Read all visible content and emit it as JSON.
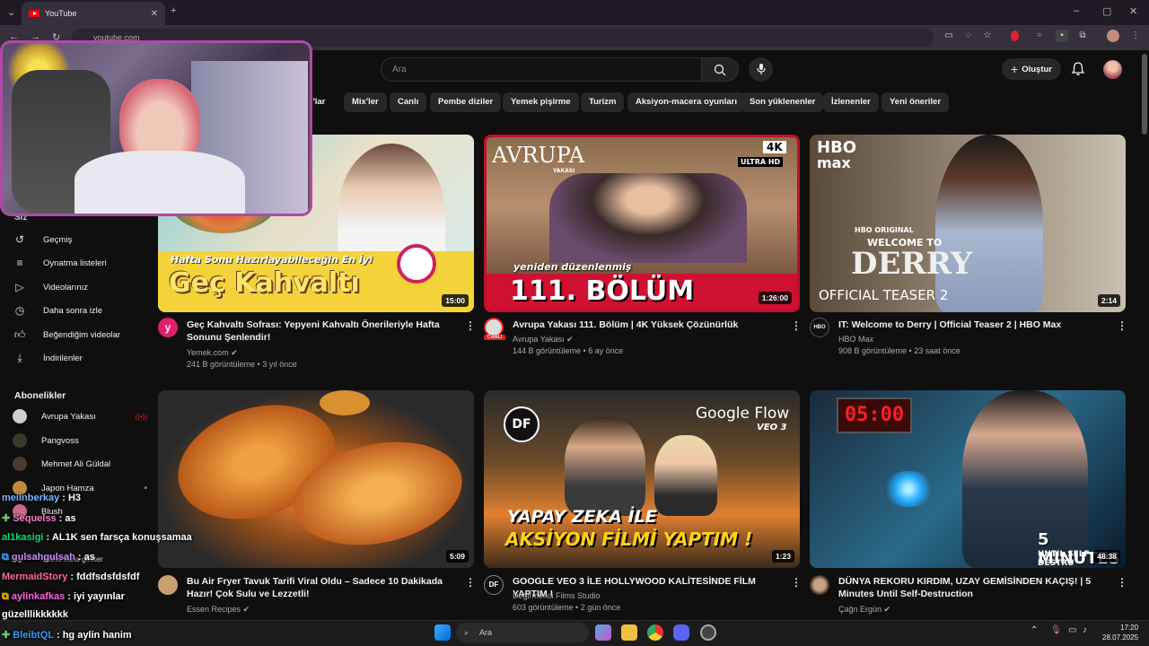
{
  "browser": {
    "tab_title": "YouTube",
    "url": "youtube.com"
  },
  "header": {
    "search_placeholder": "Ara",
    "create_label": "Oluştur"
  },
  "chips": [
    "m'lar",
    "Mix'ler",
    "Canlı",
    "Pembe diziler",
    "Yemek pişirme",
    "Turizm",
    "Aksiyon-macera oyunları",
    "Son yüklenenler",
    "İzlenenler",
    "Yeni öneriler"
  ],
  "sidebar": {
    "partial_label": "Siz",
    "items": [
      {
        "label": "Geçmiş",
        "icon": "history-icon"
      },
      {
        "label": "Oynatma listeleri",
        "icon": "playlist-icon"
      },
      {
        "label": "Videolarınız",
        "icon": "your-videos-icon"
      },
      {
        "label": "Daha sonra izle",
        "icon": "watch-later-icon"
      },
      {
        "label": "Beğendiğim videolar",
        "icon": "like-icon"
      },
      {
        "label": "İndirilenler",
        "icon": "download-icon"
      }
    ],
    "subscriptions_title": "Abonelikler",
    "subscriptions": [
      {
        "label": "Avrupa Yakası",
        "color": "#cfcfcf"
      },
      {
        "label": "Pangvoss",
        "color": "#3a3a2a"
      },
      {
        "label": "Mehmet Ali Güldal",
        "color": "#4a3a30"
      },
      {
        "label": "Japon Hamza",
        "color": "#c08a40"
      },
      {
        "label": "Blush",
        "color": "#c76a8a"
      }
    ],
    "show_more": "Daha fazla göster"
  },
  "videos": [
    {
      "title": "Geç Kahvaltı Sofrası: Yepyeni Kahvaltı Önerileriyle Hafta Sonunu Şenlendir!",
      "channel": "Yemek.com",
      "stats": "241 B görüntüleme • 3 yıl önce",
      "duration": "15:00",
      "thumb_top": "Hafta Sonu Hazırlayabileceğin En İyi",
      "thumb_main": "Geç Kahvaltı"
    },
    {
      "title": "Avrupa Yakası 111. Bölüm | 4K Yüksek Çözünürlük",
      "channel": "Avrupa Yakası",
      "stats": "144 B görüntüleme • 6 ay önce",
      "duration": "1:26:00",
      "thumb_logo": "AVRUPA",
      "thumb_logo_sub": "YAKASI",
      "thumb_badge1": "4K",
      "thumb_badge2": "ULTRA HD",
      "thumb_top": "yeniden düzenlenmiş",
      "thumb_main": "111. BÖLÜM",
      "avatar_label": "CANLI"
    },
    {
      "title": "IT: Welcome to Derry | Official Teaser 2 | HBO Max",
      "channel": "HBO Max",
      "stats": "908 B görüntüleme • 23 saat önce",
      "duration": "2:14",
      "thumb_logo": "HBO",
      "thumb_logo_sub": "max",
      "thumb_top": "HBO ORIGINAL",
      "thumb_main": "DERRY",
      "thumb_welcome": "WELCOME TO",
      "thumb_sub": "OFFICIAL TEASER 2"
    },
    {
      "title": "Bu Air Fryer Tavuk Tarifi Viral Oldu – Sadece 10 Dakikada Hazır! Çok Sulu ve Lezzetli!",
      "channel": "Essen Recipes",
      "stats": "",
      "duration": "5:09"
    },
    {
      "title": "GOOGLE VEO 3 İLE HOLLYWOOD KALİTESİNDE FİLM YAPTIM !",
      "channel": "Değirmenci Films Studio",
      "stats": "603 görüntüleme • 2 gün önce",
      "duration": "1:23",
      "thumb_logo": "Google Flow",
      "thumb_logo_sub": "VEO 3",
      "thumb_top": "YAPAY ZEKA İLE",
      "thumb_main": "AKSİYON FİLMİ YAPTIM !",
      "thumb_badge1": "DF"
    },
    {
      "title": "DÜNYA REKORU KIRDIM, UZAY GEMİSİNDEN KAÇIŞ! | 5 Minutes Until Self-Destruction",
      "channel": "Çağn Ergün",
      "stats": "",
      "duration": "48:38",
      "thumb_top": "05:00",
      "thumb_main": "5 MINUTES",
      "thumb_sub": "UNTIL SELF-DESTRU"
    }
  ],
  "chat": [
    {
      "user": "meiinberkay",
      "msg": "H3",
      "color": "#7fb3ff"
    },
    {
      "user": "Sequelss",
      "msg": "as",
      "color": "#ff7fcf"
    },
    {
      "user": "al1kasigi",
      "msg": "AL1K sen farsça konuşsamaa",
      "color": "#00e676"
    },
    {
      "user": "gulsahgulsah",
      "msg": "as",
      "color": "#c98bff"
    },
    {
      "user": "MermaidStory",
      "msg": "fddfsdsfdsfdf",
      "color": "#ff6b9e"
    },
    {
      "user": "aylinkafkas",
      "msg": "iyi yayınlar",
      "color": "#ff66d9"
    },
    {
      "user": "",
      "msg": "güzelllikkkkkk",
      "color": "#ffffff"
    },
    {
      "user": "BleibtQL",
      "msg": "hg aylin hanim",
      "color": "#2e9bff"
    }
  ],
  "taskbar": {
    "search": "Ara",
    "time": "17:20",
    "date": "28.07.2025"
  }
}
